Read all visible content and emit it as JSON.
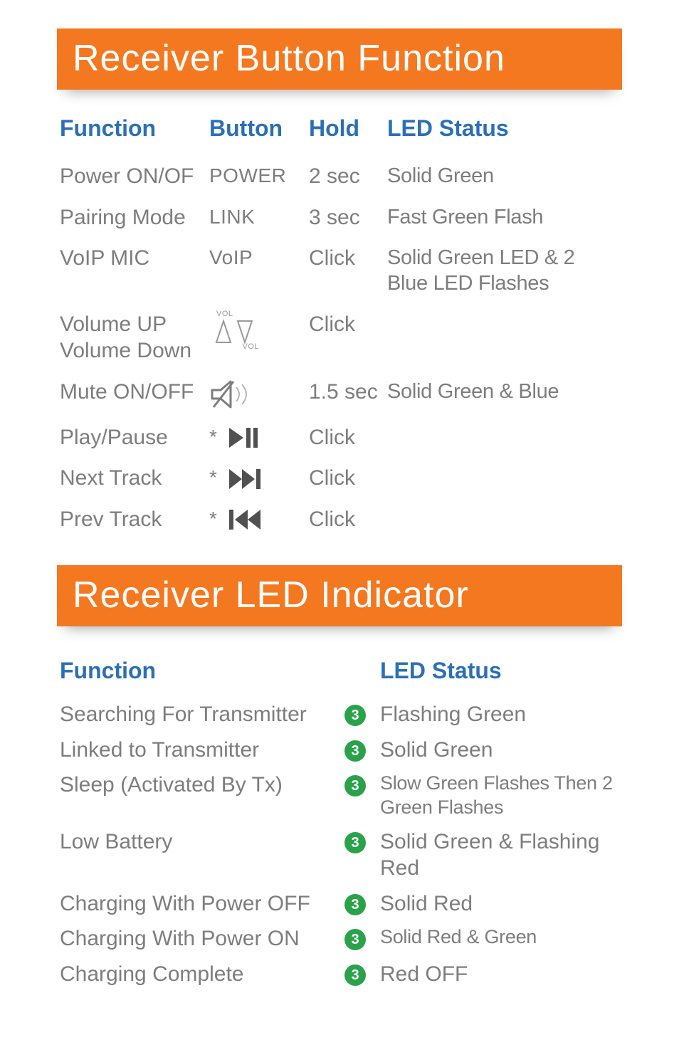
{
  "section1": {
    "title": "Receiver Button Function",
    "headers": {
      "fn": "Function",
      "btn": "Button",
      "hold": "Hold",
      "led": "LED Status"
    },
    "rows": [
      {
        "fn": "Power ON/OF",
        "btn_text": "POWER",
        "icon": "",
        "hold": "2 sec",
        "led": "Solid Green"
      },
      {
        "fn": "Pairing Mode",
        "btn_text": "LINK",
        "icon": "",
        "hold": "3 sec",
        "led": "Fast Green Flash"
      },
      {
        "fn": "VoIP MIC",
        "btn_text": "VoIP",
        "icon": "",
        "hold": "Click",
        "led": "Solid Green LED & 2 Blue LED Flashes"
      },
      {
        "fn": "Volume UP\nVolume Down",
        "btn_text": "",
        "icon": "volume-arrows",
        "hold": "Click",
        "led": ""
      },
      {
        "fn": "Mute ON/OFF",
        "btn_text": "",
        "icon": "mute",
        "hold": "1.5 sec",
        "led": "Solid Green & Blue"
      },
      {
        "fn": "Play/Pause",
        "btn_text": "*",
        "icon": "playpause",
        "hold": "Click",
        "led": ""
      },
      {
        "fn": "Next Track",
        "btn_text": "*",
        "icon": "next",
        "hold": "Click",
        "led": ""
      },
      {
        "fn": "Prev Track",
        "btn_text": "*",
        "icon": "prev",
        "hold": "Click",
        "led": ""
      }
    ]
  },
  "section2": {
    "title": "Receiver LED Indicator",
    "headers": {
      "fn": "Function",
      "led": "LED Status"
    },
    "badge": "3",
    "rows": [
      {
        "fn": "Searching For Transmitter",
        "led": "Flashing Green"
      },
      {
        "fn": "Linked to Transmitter",
        "led": "Solid Green"
      },
      {
        "fn": "Sleep (Activated By Tx)",
        "led": "Slow Green Flashes Then 2 Green Flashes",
        "sm": true
      },
      {
        "fn": "Low Battery",
        "led": "Solid Green & Flashing Red"
      },
      {
        "fn": "Charging With Power OFF",
        "led": "Solid Red"
      },
      {
        "fn": "Charging With Power ON",
        "led": "Solid Red & Green",
        "sm": true
      },
      {
        "fn": "Charging Complete",
        "led": "Red OFF"
      }
    ]
  }
}
